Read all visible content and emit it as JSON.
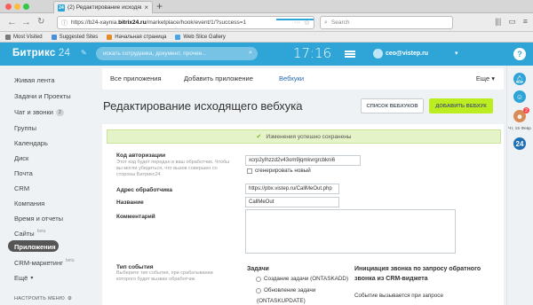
{
  "browser": {
    "tab_title": "(2) Редактирование исходящ",
    "tab_favicon": "24",
    "url_prefix": "https://b24-xaynia.",
    "url_domain": "bitrix24.ru",
    "url_suffix": "/marketplace/hook/event/1/?success=1",
    "search_placeholder": "Search",
    "bookmarks": [
      "Most Visited",
      "Suggested Sites",
      "Начальная страница",
      "Web Slice Gallery"
    ]
  },
  "header": {
    "logo_main": "Битрикс",
    "logo_num": " 24",
    "search_placeholder": "искать сотрудника, документ, прочее...",
    "clock": "17:16",
    "user_email": "ceo@vistep.ru"
  },
  "rail": {
    "help_label": "?",
    "badge": "2",
    "date": "Чт, 15 Февр",
    "b24_label": "24"
  },
  "menu": {
    "items": [
      {
        "label": "Живая лента"
      },
      {
        "label": "Задачи и Проекты"
      },
      {
        "label": "Чат и звонки",
        "count": "2"
      },
      {
        "label": "Группы"
      },
      {
        "label": "Календарь"
      },
      {
        "label": "Диск"
      },
      {
        "label": "Почта"
      },
      {
        "label": "CRM"
      },
      {
        "label": "Компания"
      },
      {
        "label": "Время и отчеты"
      },
      {
        "label": "Сайты",
        "beta": "beta"
      },
      {
        "label": "Приложения"
      },
      {
        "label": "CRM-маркетинг",
        "beta": "beta"
      },
      {
        "label": "Ещё"
      }
    ],
    "settings": "НАСТРОИТЬ МЕНЮ"
  },
  "tabs": {
    "all_apps": "Все приложения",
    "add_app": "Добавить приложение",
    "webhooks": "Вебхуки",
    "more": "Еще"
  },
  "page": {
    "title": "Редактирование исходящего вебхука",
    "btn_list": "СПИСОК ВЕБХУКОВ",
    "btn_add": "ДОБАВИТЬ ВЕБХУК",
    "success_msg": "Изменения успешно сохранены"
  },
  "form": {
    "auth_code_label": "Код авторизации",
    "auth_code_hint": "Этот код будет передан в ваш обработчик. Чтобы вы могли убедиться, что вызов совершен со стороны Битрикс24",
    "auth_code_value": "xcrp2yIhzzd2v43om9jqmkvrgrcbkni6",
    "regenerate_label": "сгенерировать новый",
    "handler_label": "Адрес обработчика",
    "handler_value": "https://pbx.vistep.ru/CallMeOut.php",
    "name_label": "Название",
    "name_value": "CallMeOut",
    "comment_label": "Комментарий",
    "event_type_label": "Тип события",
    "event_type_hint": "Выберите тип события, при срабатывании которого будет вызван обработчик"
  },
  "events": {
    "tasks_header": "Задачи",
    "task_add": "Создание задачи (ONTASKADD)",
    "task_update": "Обновление задачи",
    "task_update_code": "(ONTASKUPDATE)",
    "call_header_1": "Инициация звонка по запросу обратного",
    "call_header_2": "звонка из CRM-виджета",
    "call_text": "Событие вызывается при запросе"
  }
}
